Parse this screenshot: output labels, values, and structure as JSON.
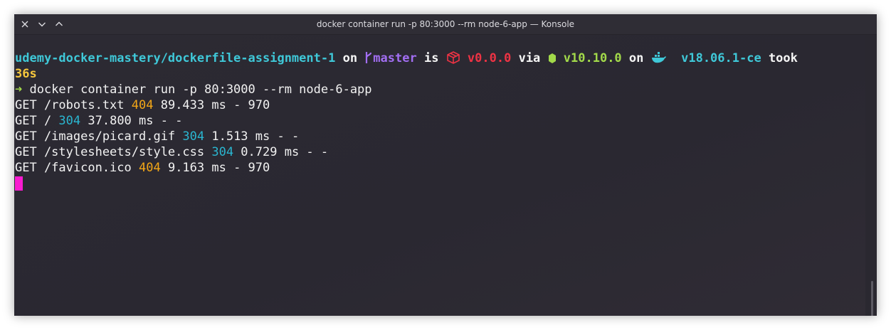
{
  "window": {
    "title": "docker container run -p 80:3000 --rm node-6-app — Konsole",
    "controls": [
      "close-icon",
      "minimize-icon",
      "maximize-icon"
    ]
  },
  "colors": {
    "background": "#2a2830",
    "path": "#3fc8d8",
    "branch": "#a26ef2",
    "package": "#ee3344",
    "node": "#a2d94a",
    "docker": "#3fc8d8",
    "duration": "#f6c73d",
    "status_404": "#f2a617",
    "status_304": "#2ab6d0",
    "cursor": "#f91bd0"
  },
  "prompt": {
    "path": "udemy-docker-mastery/dockerfile-assignment-1",
    "on_1": " on ",
    "branch_icon": "git-branch-icon",
    "branch": "master",
    "is": " is ",
    "package_icon": "package-icon",
    "package_version": "v0.0.0",
    "via": " via ",
    "node_icon": "node-icon",
    "node_version": "v10.10.0",
    "on_2": " on ",
    "docker_icon": "docker-whale-icon",
    "docker_version": "v18.06.1-ce",
    "took": " took",
    "duration": "36s",
    "arrow": "➜",
    "command": " docker container run -p 80:3000 --rm node-6-app"
  },
  "log": [
    {
      "pre": "GET /robots.txt ",
      "status": "404",
      "post": " 89.433 ms - 970"
    },
    {
      "pre": "GET / ",
      "status": "304",
      "post": " 37.800 ms - -"
    },
    {
      "pre": "GET /images/picard.gif ",
      "status": "304",
      "post": " 1.513 ms - -"
    },
    {
      "pre": "GET /stylesheets/style.css ",
      "status": "304",
      "post": " 0.729 ms - -"
    },
    {
      "pre": "GET /favicon.ico ",
      "status": "404",
      "post": " 9.163 ms - 970"
    }
  ]
}
